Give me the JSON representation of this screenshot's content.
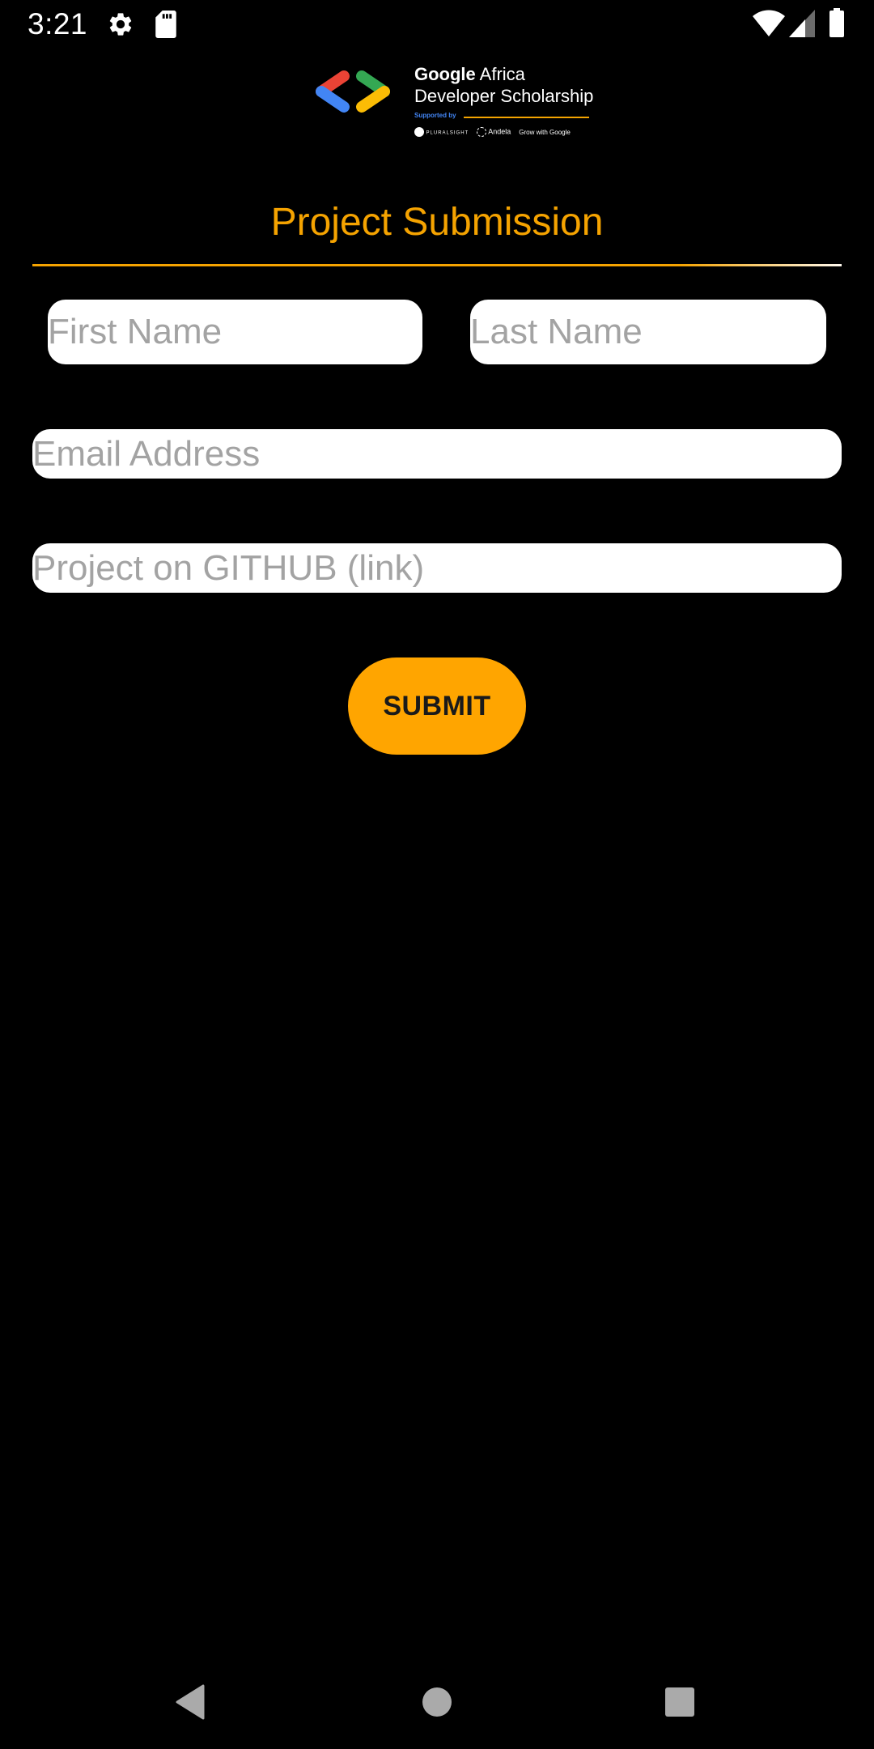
{
  "status_bar": {
    "time": "3:21",
    "icons": [
      "settings-icon",
      "sd-card-icon",
      "wifi-icon",
      "signal-icon",
      "battery-icon"
    ]
  },
  "logo": {
    "title_strong": "Google",
    "title_rest": " Africa",
    "subtitle": "Developer Scholarship",
    "supported_by": "Supported by",
    "partners": [
      "PLURALSIGHT",
      "Andela",
      "Grow with Google"
    ]
  },
  "page": {
    "title": "Project Submission"
  },
  "form": {
    "first_name_placeholder": "First Name",
    "last_name_placeholder": "Last Name",
    "email_placeholder": "Email Address",
    "github_placeholder": "Project on GITHUB (link)",
    "submit_label": "SUBMIT"
  },
  "navigation": {
    "buttons": [
      "back-icon",
      "home-icon",
      "recents-icon"
    ]
  },
  "colors": {
    "accent": "#ffa500",
    "title": "#f5a300",
    "background": "#000000",
    "field": "#ffffff",
    "placeholder": "#a3a3a3"
  }
}
